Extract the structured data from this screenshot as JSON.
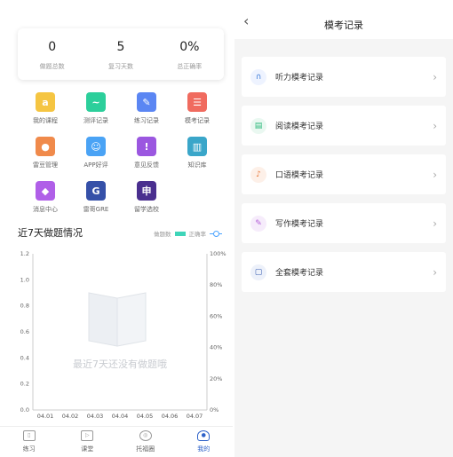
{
  "stats": [
    {
      "value": "0",
      "label": "做题总数"
    },
    {
      "value": "5",
      "label": "复习天数"
    },
    {
      "value": "0%",
      "label": "总正确率"
    }
  ],
  "grid": [
    {
      "label": "我的课程",
      "icon": "course-icon",
      "color": "#f5c542",
      "glyph": "a"
    },
    {
      "label": "测评记录",
      "icon": "assessment-icon",
      "color": "#2ccf9b",
      "glyph": "~"
    },
    {
      "label": "练习记录",
      "icon": "practice-icon",
      "color": "#5b86f3",
      "glyph": "✎"
    },
    {
      "label": "模考记录",
      "icon": "mock-icon",
      "color": "#f06b5f",
      "glyph": "☰"
    },
    {
      "label": "雷豆管理",
      "icon": "bean-icon",
      "color": "#f08a4b",
      "glyph": "●"
    },
    {
      "label": "APP好评",
      "icon": "smile-icon",
      "color": "#4aa3f5",
      "glyph": "☺"
    },
    {
      "label": "意见反馈",
      "icon": "feedback-icon",
      "color": "#9b57e0",
      "glyph": "!"
    },
    {
      "label": "知识库",
      "icon": "library-icon",
      "color": "#3aa6c9",
      "glyph": "▥"
    },
    {
      "label": "消息中心",
      "icon": "bell-icon",
      "color": "#b05fe8",
      "glyph": "◆"
    },
    {
      "label": "雷哥GRE",
      "icon": "gre-icon",
      "color": "#3550a8",
      "glyph": "G"
    },
    {
      "label": "留学选校",
      "icon": "school-icon",
      "color": "#4a2f8f",
      "glyph": "申"
    }
  ],
  "chart": {
    "title": "近7天做题情况",
    "legend_bar": "做题数",
    "legend_line": "正确率",
    "empty_text": "最近7天还没有做题哦"
  },
  "chart_data": {
    "type": "bar",
    "categories": [
      "04.01",
      "04.02",
      "04.03",
      "04.04",
      "04.05",
      "04.06",
      "04.07"
    ],
    "series": [
      {
        "name": "做题数",
        "values": [
          0,
          0,
          0,
          0,
          0,
          0,
          0
        ]
      },
      {
        "name": "正确率",
        "values": [
          0,
          0,
          0,
          0,
          0,
          0,
          0
        ]
      }
    ],
    "ylim": [
      0,
      1.2
    ],
    "yticks": [
      "0.0",
      "0.2",
      "0.4",
      "0.6",
      "0.8",
      "1.0",
      "1.2"
    ],
    "y2lim": [
      0,
      100
    ],
    "y2ticks": [
      "0%",
      "20%",
      "40%",
      "60%",
      "80%",
      "100%"
    ],
    "bar_color": "#3fd5b9",
    "line_color": "#4aa3ff"
  },
  "tabs": [
    {
      "label": "练习",
      "glyph": "▯"
    },
    {
      "label": "课堂",
      "glyph": "▷"
    },
    {
      "label": "托福圈",
      "glyph": "◎"
    },
    {
      "label": "我的",
      "glyph": "●"
    }
  ],
  "right": {
    "back": "‹",
    "title": "模考记录",
    "items": [
      {
        "label": "听力模考记录",
        "icon": "headphones-icon",
        "color": "#3b7bd8",
        "bg": "#eef3ff",
        "glyph": "∩"
      },
      {
        "label": "阅读模考记录",
        "icon": "document-icon",
        "color": "#2ab87a",
        "bg": "#eaf8f1",
        "glyph": "▤"
      },
      {
        "label": "口语模考记录",
        "icon": "microphone-icon",
        "color": "#e87a3c",
        "bg": "#fdf0e8",
        "glyph": "♪"
      },
      {
        "label": "写作模考记录",
        "icon": "pencil-icon",
        "color": "#b45fd8",
        "bg": "#f6ecfb",
        "glyph": "✎"
      },
      {
        "label": "全套模考记录",
        "icon": "book-icon",
        "color": "#3a5fb0",
        "bg": "#edf1fa",
        "glyph": "▢"
      }
    ]
  }
}
